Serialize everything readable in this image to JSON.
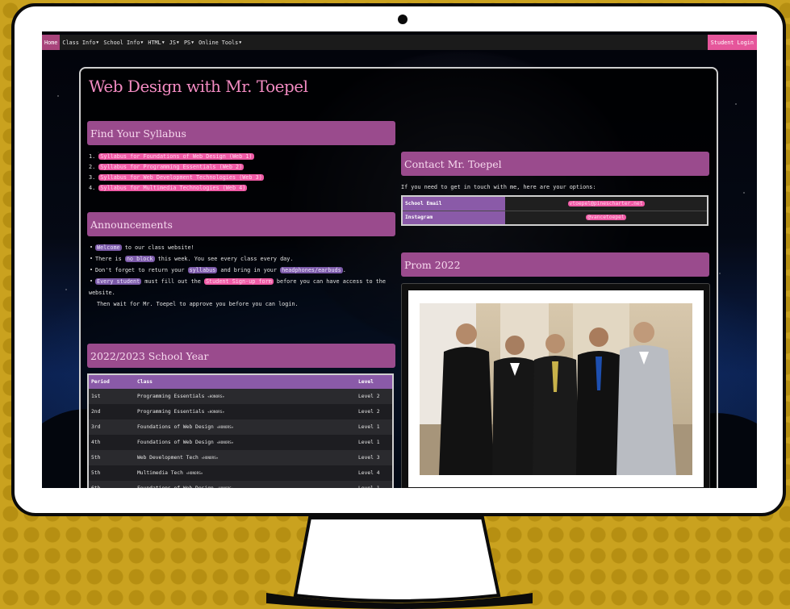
{
  "nav": {
    "home": "Home",
    "class_info": "Class Info",
    "school_info": "School Info",
    "html": "HTML",
    "js": "JS",
    "ps": "PS",
    "online_tools": "Online Tools",
    "caret": "▼",
    "login": "Student Login"
  },
  "page_title": "Web Design with Mr. Toepel",
  "syllabus": {
    "heading": "Find Your Syllabus",
    "items": [
      {
        "num": "1.",
        "label": "Syllabus for Foundations of Web Design (Web 1)"
      },
      {
        "num": "2.",
        "label": "Syllabus for Programming Essentials (Web 2)"
      },
      {
        "num": "3.",
        "label": "Syllabus for Web Development Technologies (Web 3)"
      },
      {
        "num": "4.",
        "label": "Syllabus for Multimedia Technologies (Web 4)"
      }
    ]
  },
  "announcements": {
    "heading": "Announcements",
    "a1_pill": "Welcome",
    "a1_text": " to our class website!",
    "a2_pre": "There is ",
    "a2_pill": "no block",
    "a2_post": " this week. You see every class every day.",
    "a3_pre": "Don't forget to return your ",
    "a3_pill": "syllabus",
    "a3_mid": " and bring in your ",
    "a3_pill2": "headphones/earbuds",
    "a3_post": ".",
    "a4_pill": "Every student",
    "a4_mid": " must fill out the ",
    "a4_pill2": "Student Sign-up form",
    "a4_post": " before you can have access to the website.",
    "a4_line2": "Then wait for Mr. Toepel to approve you before you can login."
  },
  "school_year": {
    "heading": "2022/2023 School Year",
    "columns": [
      "Period",
      "Class",
      "Level"
    ],
    "honors_tag": "«HONORS»",
    "rows": [
      {
        "period": "1st",
        "class": "Programming Essentials",
        "level": "Level 2"
      },
      {
        "period": "2nd",
        "class": "Programming Essentials",
        "level": "Level 2"
      },
      {
        "period": "3rd",
        "class": "Foundations of Web Design",
        "level": "Level 1"
      },
      {
        "period": "4th",
        "class": "Foundations of Web Design",
        "level": "Level 1"
      },
      {
        "period": "5th",
        "class": "Web Development Tech",
        "level": "Level 3"
      },
      {
        "period": "5th",
        "class": "Multimedia Tech",
        "level": "Level 4"
      },
      {
        "period": "6th",
        "class": "Foundations of Web Design",
        "level": "Level 1"
      }
    ]
  },
  "contact": {
    "heading": "Contact Mr. Toepel",
    "intro": "If you need to get in touch with me, here are your options:",
    "email_label": "School Email",
    "email_value": "vtoepel@pinescharter.net",
    "insta_label": "Instagram",
    "insta_value": "@vancetoepel"
  },
  "prom": {
    "heading": "Prom 2022"
  },
  "colors": {
    "accent_pink": "#ef5aa5",
    "section_purple": "#9a4b8d",
    "table_header": "#8a5aa8",
    "background_gold": "#caa21f"
  }
}
